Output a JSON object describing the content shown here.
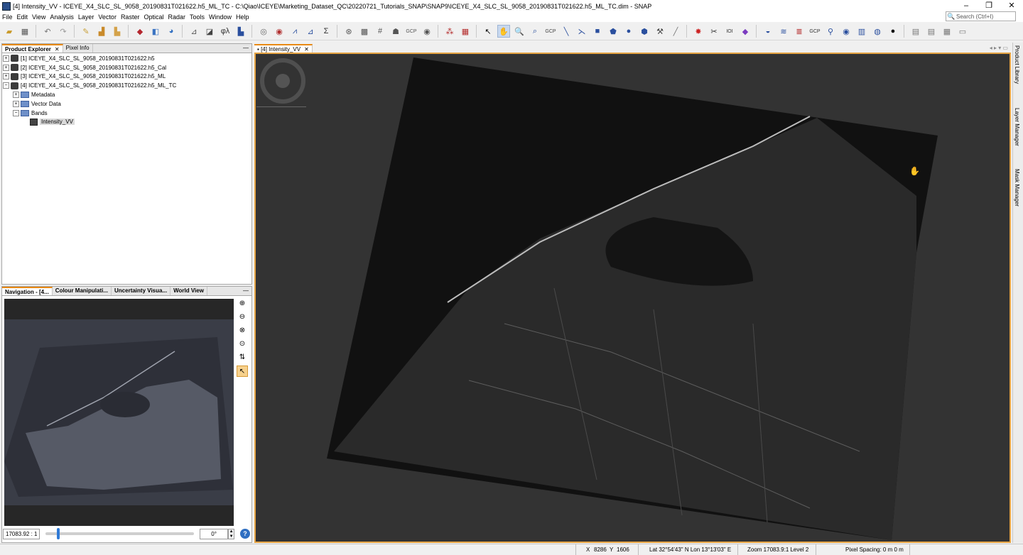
{
  "window": {
    "title": "[4] Intensity_VV - ICEYE_X4_SLC_SL_9058_20190831T021622.h5_ML_TC - C:\\Qiao\\ICEYE\\Marketing_Dataset_QC\\20220721_Tutorials_SNAP\\SNAP9\\ICEYE_X4_SLC_SL_9058_20190831T021622.h5_ML_TC.dim - SNAP",
    "minimize": "–",
    "maximize": "❐",
    "close": "✕"
  },
  "menu": [
    "File",
    "Edit",
    "View",
    "Analysis",
    "Layer",
    "Vector",
    "Raster",
    "Optical",
    "Radar",
    "Tools",
    "Window",
    "Help"
  ],
  "search": {
    "placeholder": "Search (Ctrl+I)"
  },
  "toolbar_icons": [
    "open-product-icon",
    "save-product-icon",
    "undo-icon",
    "redo-icon",
    "spectrum-icon",
    "export-icon",
    "import-icon",
    "color-manip-icon",
    "gcp-icon",
    "worldwind-icon",
    "pin-icon",
    "polygon-icon",
    "band-maths-icon",
    "histogram-icon",
    "scatter-icon",
    "profile-icon",
    "statistics-icon",
    "information-icon",
    "sum-icon",
    "time-series-icon",
    "graph-builder-icon",
    "batch-icon",
    "gcp-tool-icon",
    "eye-icon",
    "select-icon",
    "pan-icon",
    "zoom-tool-icon",
    "zoom-gcp-icon",
    "range-finder-icon",
    "pin-tool-icon",
    "rectangle-icon",
    "polyline-icon",
    "ellipse-icon",
    "lasso-icon",
    "magic-wand-icon",
    "draw-icon",
    "cut-icon",
    "pixel-info-icon",
    "grid-icon",
    "target-icon",
    "globe-icon",
    "layout-1-icon",
    "layout-2-icon",
    "layout-3-icon",
    "layout-4-icon"
  ],
  "product_explorer": {
    "tabs": [
      {
        "label": "Product Explorer",
        "close": "✕"
      },
      {
        "label": "Pixel Info",
        "close": ""
      }
    ],
    "products": [
      "[1] ICEYE_X4_SLC_SL_9058_20190831T021622.h5",
      "[2] ICEYE_X4_SLC_SL_9058_20190831T021622.h5_Cal",
      "[3] ICEYE_X4_SLC_SL_9058_20190831T021622.h5_ML",
      "[4] ICEYE_X4_SLC_SL_9058_20190831T021622.h5_ML_TC"
    ],
    "children": [
      "Metadata",
      "Vector Data",
      "Bands"
    ],
    "band": "Intensity_VV"
  },
  "nav_panel": {
    "tabs": [
      "Navigation - [4...",
      "Colour Manipulati...",
      "Uncertainty Visua...",
      "World View"
    ],
    "zoom_value": "17083.92 : 1",
    "angle": "0°",
    "help": "?",
    "zoom_progress": 0.08
  },
  "image_view": {
    "tab": "[4] Intensity_VV",
    "close": "✕"
  },
  "side_tabs": [
    "Product Library",
    "Layer Manager",
    "Mask Manager"
  ],
  "status": {
    "x_label": "X",
    "x": "8286",
    "y_label": "Y",
    "y": "1606",
    "latlon": "Lat 32°54'43\" N  Lon 13°13'03\" E",
    "zoom": "Zoom 17083.9:1  Level 2",
    "pixel_spacing": "Pixel Spacing: 0 m 0 m"
  },
  "colors": {
    "accent": "#e6a443",
    "viewer_bg": "#333333",
    "active_tab": "#e98a14"
  }
}
